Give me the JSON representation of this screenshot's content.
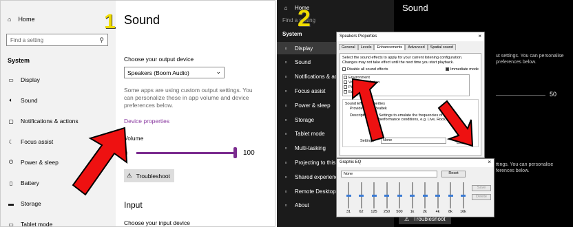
{
  "panel1": {
    "number": "1",
    "sidebar": {
      "home": "Home",
      "search_placeholder": "Find a setting",
      "section": "System",
      "items": [
        {
          "label": "Display",
          "icon": "display-icon"
        },
        {
          "label": "Sound",
          "icon": "speaker-icon"
        },
        {
          "label": "Notifications & actions",
          "icon": "notification-icon"
        },
        {
          "label": "Focus assist",
          "icon": "moon-icon"
        },
        {
          "label": "Power & sleep",
          "icon": "power-icon"
        },
        {
          "label": "Battery",
          "icon": "battery-icon"
        },
        {
          "label": "Storage",
          "icon": "storage-icon"
        },
        {
          "label": "Tablet mode",
          "icon": "tablet-icon"
        }
      ]
    },
    "title": "Sound",
    "output_label": "Choose your output device",
    "output_device": "Speakers (Boom Audio)",
    "desc": "Some apps are using custom output settings. You can personalize these in app volume and device preferences below.",
    "device_properties": "Device properties",
    "volume_label": "Volume",
    "volume_value": "100",
    "troubleshoot": "Troubleshoot",
    "input_heading": "Input",
    "input_label": "Choose your input device"
  },
  "panel2": {
    "number": "2",
    "sidebar": {
      "home": "Home",
      "search": "Find a setting",
      "section": "System",
      "items": [
        {
          "label": "Display",
          "selected": true
        },
        {
          "label": "Sound"
        },
        {
          "label": "Notifications & actions"
        },
        {
          "label": "Focus assist"
        },
        {
          "label": "Power & sleep"
        },
        {
          "label": "Storage"
        },
        {
          "label": "Tablet mode"
        },
        {
          "label": "Multi-tasking"
        },
        {
          "label": "Projecting to this PC"
        },
        {
          "label": "Shared experiences"
        },
        {
          "label": "Remote Desktop"
        },
        {
          "label": "About"
        }
      ]
    },
    "title": "Sound",
    "bg_text1": "ut settings. You can personalise",
    "bg_text2": "preferences below.",
    "bg_value": "50",
    "bg_text3": "ttings. You can personalise",
    "bg_text4": "ferences below.",
    "troubleshoot": "Troubleshoot",
    "dialog": {
      "title": "Speakers Properties",
      "tabs": [
        "General",
        "Levels",
        "Enhancements",
        "Advanced",
        "Spatial sound"
      ],
      "desc": "Select the sound effects to apply for your current listening configuration. Changes may not take effect until the next time you start playback.",
      "disable_all": "Disable all sound effects",
      "immediate": "Immediate mode",
      "effects": [
        "Environment",
        "Voice Cancellation",
        "Pitch Shift",
        "Equalizer"
      ],
      "props_label": "Sound Effect Properties",
      "provider_label": "Provider :",
      "provider": "Realtek",
      "desc_label": "Description :",
      "effect_desc": "Settings to emulate the frequencies of various performance conditions, e.g. Live, Rock, etc.",
      "setting_label": "Setting :",
      "setting_value": "None",
      "more_btn": "..."
    },
    "eq": {
      "title": "Graphic EQ",
      "preset": "None",
      "reset": "Reset",
      "save": "Save",
      "delete": "Delete",
      "bands": [
        "31",
        "62",
        "125",
        "250",
        "500",
        "1k",
        "2k",
        "4k",
        "8k",
        "16k"
      ]
    }
  }
}
